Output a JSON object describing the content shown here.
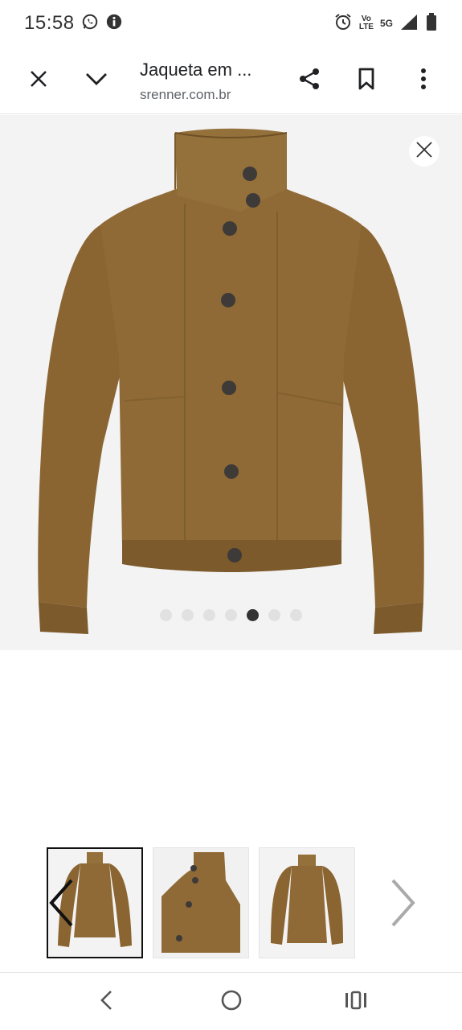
{
  "status_bar": {
    "time": "15:58",
    "network_top": "Vo",
    "network_bottom": "LTE",
    "network_5g": "5G",
    "icons": [
      "whatsapp-icon",
      "info-icon",
      "alarm-icon",
      "signal-icon",
      "battery-icon"
    ]
  },
  "toolbar": {
    "title": "Jaqueta em ...",
    "url": "srenner.com.br",
    "icons": [
      "close-icon",
      "chevron-down-icon",
      "share-icon",
      "bookmark-icon",
      "more-vert-icon"
    ]
  },
  "gallery": {
    "dot_count": 7,
    "active_dot": 4,
    "product_color": "#8a6532"
  },
  "thumbnails": {
    "count": 3,
    "selected": 0,
    "icons": [
      "chevron-left-icon",
      "chevron-right-icon"
    ]
  },
  "navbar": {
    "icons": [
      "back-icon",
      "home-icon",
      "recents-icon"
    ]
  }
}
